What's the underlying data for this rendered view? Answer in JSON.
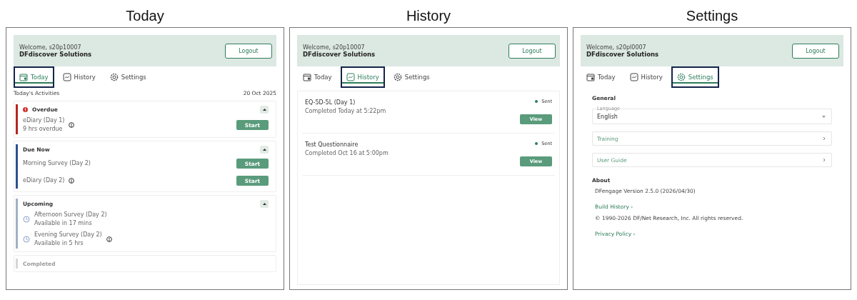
{
  "screens": [
    {
      "caption": "Today",
      "header": {
        "welcome": "Welcome, s20p10007",
        "org": "DFdiscover Solutions",
        "logout": "Logout"
      },
      "tabs": [
        {
          "label": "Today",
          "kind": "today",
          "selected": true
        },
        {
          "label": "History",
          "kind": "history",
          "selected": false
        },
        {
          "label": "Settings",
          "kind": "settings",
          "selected": false
        }
      ],
      "activities": {
        "title": "Today's Activities",
        "date": "20 Oct 2025",
        "groups": [
          {
            "title": "Overdue",
            "color": "#b3261e",
            "alert": true,
            "expanded": true,
            "disabled": false,
            "items": [
              {
                "kind": "action",
                "name": "eDiary (Day 1)",
                "note": "9 hrs overdue",
                "info": true,
                "action": "Start"
              }
            ]
          },
          {
            "title": "Due Now",
            "color": "#2d4f8e",
            "alert": false,
            "expanded": true,
            "disabled": false,
            "items": [
              {
                "kind": "action",
                "name": "Morning Survey (Day 2)",
                "info": false,
                "action": "Start"
              },
              {
                "kind": "action",
                "name": "eDiary (Day 2)",
                "info": true,
                "action": "Start"
              }
            ]
          },
          {
            "title": "Upcoming",
            "color": "#9fb0c8",
            "alert": false,
            "expanded": true,
            "disabled": false,
            "items": [
              {
                "kind": "scheduled",
                "name": "Afternoon Survey (Day 2)",
                "note": "Available in 17 mins",
                "info": false
              },
              {
                "kind": "scheduled",
                "name": "Evening Survey (Day 2)",
                "note": "Available in 5 hrs",
                "info": true
              }
            ]
          },
          {
            "title": "Completed",
            "color": "#d6d6d6",
            "alert": false,
            "disabled": true
          }
        ]
      }
    },
    {
      "caption": "History",
      "header": {
        "welcome": "Welcome, s20p10007",
        "org": "DFdiscover Solutions",
        "logout": "Logout"
      },
      "tabs": [
        {
          "label": "Today",
          "kind": "today",
          "selected": false
        },
        {
          "label": "History",
          "kind": "history",
          "selected": true
        },
        {
          "label": "Settings",
          "kind": "settings",
          "selected": false
        }
      ],
      "history": [
        {
          "title": "EQ-5D-5L (Day 1)",
          "subtitle": "Completed Today at 5:22pm",
          "status": "Sent",
          "color": "#2e7d5b",
          "action": "View"
        },
        {
          "title": "Test Questionnaire",
          "subtitle": "Completed Oct 16 at 5:00pm",
          "status": "Sent",
          "color": "#2e7d5b",
          "action": "View"
        }
      ]
    },
    {
      "caption": "Settings",
      "header": {
        "welcome": "Welcome, s20pl0007",
        "org": "DFdiscover Solutions",
        "logout": "Logout"
      },
      "tabs": [
        {
          "label": "Today",
          "kind": "today",
          "selected": false
        },
        {
          "label": "History",
          "kind": "history",
          "selected": false
        },
        {
          "label": "Settings",
          "kind": "settings",
          "selected": true
        }
      ],
      "settings": {
        "general_title": "General",
        "language": {
          "label": "Language",
          "value": "English"
        },
        "links": [
          "Training",
          "User Guide"
        ],
        "about_title": "About",
        "about": [
          {
            "kind": "text",
            "text": "DFengage Version 2.5.0 (2026/04/30)"
          },
          {
            "kind": "link",
            "text": "Build History ›"
          },
          {
            "kind": "text",
            "text": "© 1990-2026 DF/Net Research, Inc. All rights reserved."
          },
          {
            "kind": "link",
            "text": "Privacy Policy ›"
          }
        ]
      }
    }
  ]
}
